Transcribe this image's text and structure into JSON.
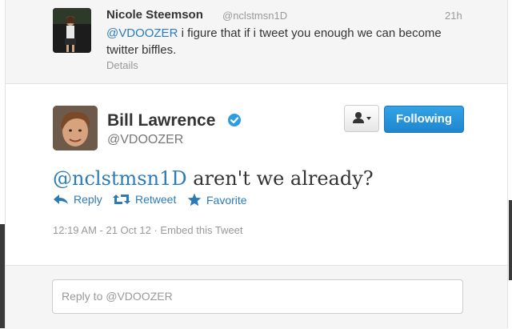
{
  "previous_tweet": {
    "name": "Nicole Steemson",
    "handle": "@nclstmsn1D",
    "time": "21h",
    "mention": "@VDOOZER",
    "text": " i figure that if i tweet you enough we can become twitter biffles.",
    "details_link": "Details"
  },
  "main_tweet": {
    "name": "Bill Lawrence",
    "handle": "@VDOOZER",
    "verified": true,
    "follow_button": "Following",
    "mention": "@nclstmsn1D",
    "text": " aren't we already?",
    "actions": {
      "reply": "Reply",
      "retweet": "Retweet",
      "favorite": "Favorite"
    },
    "timestamp": "12:19 AM - 21 Oct 12",
    "separator": " · ",
    "embed_link": "Embed this Tweet"
  },
  "reply": {
    "placeholder": "Reply to @VDOOZER"
  },
  "colors": {
    "link": "#2b7bb9",
    "follow_button": "#2a96dc",
    "muted": "#999999"
  }
}
